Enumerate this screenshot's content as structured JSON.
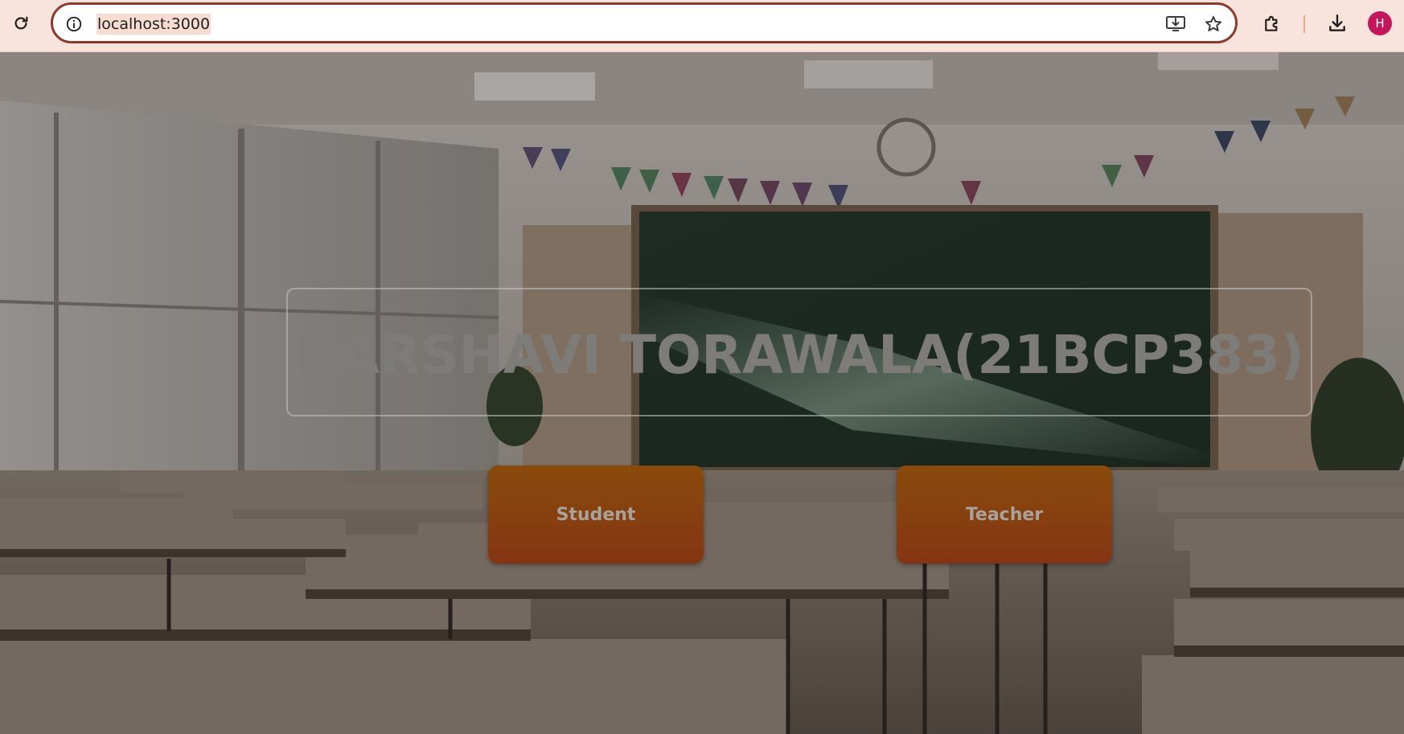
{
  "browser": {
    "url": "localhost:3000",
    "avatar_letter": "H",
    "icons": {
      "reload": "reload-icon",
      "site_info": "info-icon",
      "install": "install-app-icon",
      "bookmark": "star-icon",
      "extensions": "puzzle-icon",
      "downloads": "download-icon"
    },
    "colors": {
      "chrome_bg": "#f9e4dd",
      "omnibox_border": "#8c3a2a",
      "avatar_bg": "#c2185b"
    }
  },
  "page": {
    "title": "HARSHAVI TORAWALA(21BCP383)",
    "buttons": {
      "student": "Student",
      "teacher": "Teacher"
    },
    "colors": {
      "button_top": "#894b0b",
      "button_bottom": "#853413",
      "title_text": "#7e7c79"
    }
  }
}
